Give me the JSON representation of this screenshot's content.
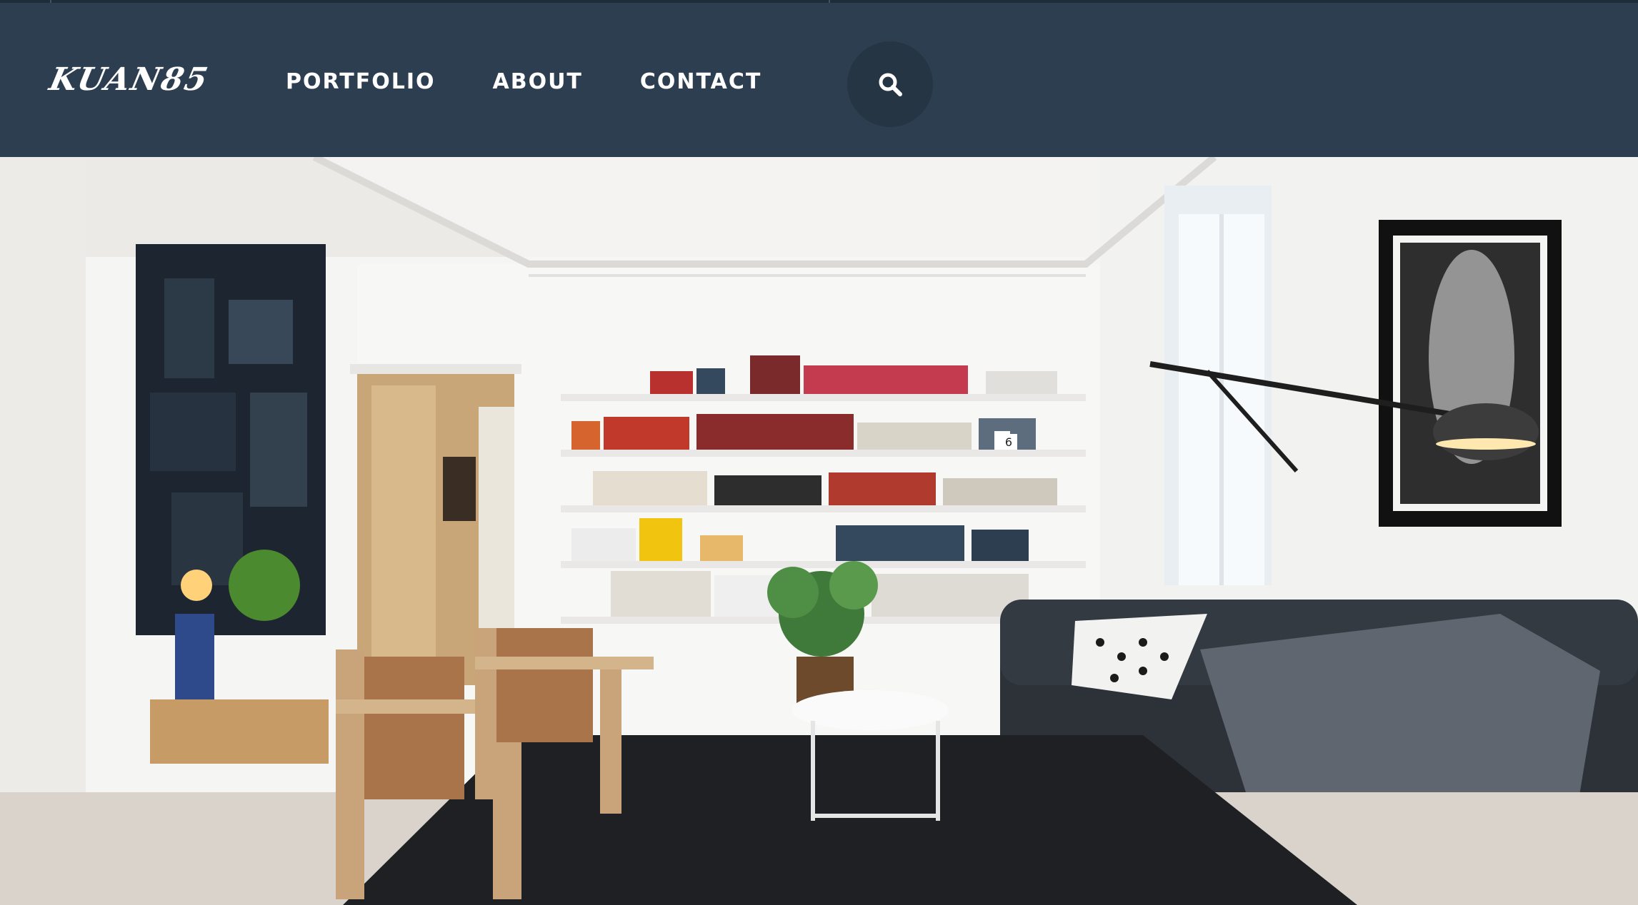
{
  "brand": {
    "logo_text": "KUAN85"
  },
  "nav": {
    "items": [
      {
        "label": "PORTFOLIO"
      },
      {
        "label": "ABOUT"
      },
      {
        "label": "CONTACT"
      }
    ],
    "search_icon": "search-icon"
  },
  "hero": {
    "icon": "living-room-photo",
    "shelf_tag": "6"
  },
  "colors": {
    "navbar_bg": "#2c3e50",
    "search_bg": "#263544",
    "text": "#ffffff"
  }
}
